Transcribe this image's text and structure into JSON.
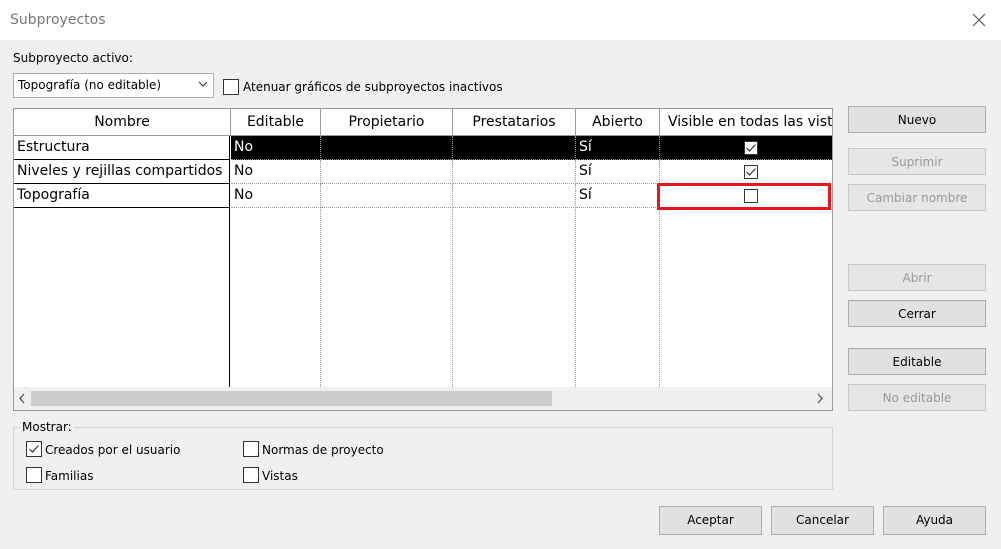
{
  "window": {
    "title": "Subproyectos"
  },
  "active": {
    "label": "Subproyecto activo:",
    "selected": "Topografía (no editable)"
  },
  "dim_inactive": {
    "label": "Atenuar gráficos de subproyectos inactivos",
    "checked": false
  },
  "grid": {
    "columns": [
      "Nombre",
      "Editable",
      "Propietario",
      "Prestatarios",
      "Abierto",
      "Visible en todas las vistas"
    ],
    "rows": [
      {
        "name": "Estructura",
        "editable": "No",
        "owner": "",
        "borrowers": "",
        "open": "Sí",
        "visible": true,
        "selected": true
      },
      {
        "name": "Niveles y rejillas compartidos",
        "editable": "No",
        "owner": "",
        "borrowers": "",
        "open": "Sí",
        "visible": true,
        "selected": false
      },
      {
        "name": "Topografía",
        "editable": "No",
        "owner": "",
        "borrowers": "",
        "open": "Sí",
        "visible": false,
        "selected": false
      }
    ]
  },
  "side_buttons": {
    "nuevo": "Nuevo",
    "suprimir": "Suprimir",
    "cambiar_nombre": "Cambiar nombre",
    "abrir": "Abrir",
    "cerrar": "Cerrar",
    "editable": "Editable",
    "no_editable": "No editable"
  },
  "show": {
    "title": "Mostrar:",
    "user_created": {
      "label": "Creados por el usuario",
      "checked": true
    },
    "families": {
      "label": "Familias",
      "checked": false
    },
    "project_standards": {
      "label": "Normas de proyecto",
      "checked": false
    },
    "views": {
      "label": "Vistas",
      "checked": false
    }
  },
  "footer": {
    "ok": "Aceptar",
    "cancel": "Cancelar",
    "help": "Ayuda"
  },
  "colors": {
    "highlight": "#e8141b",
    "selected_row": "#000000"
  }
}
